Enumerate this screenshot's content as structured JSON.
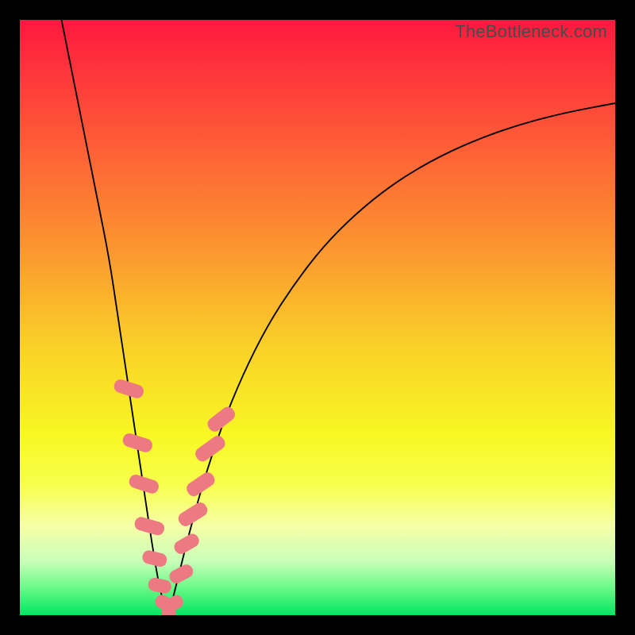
{
  "watermark": "TheBottleneck.com",
  "chart_data": {
    "type": "line",
    "title": "",
    "xlabel": "",
    "ylabel": "",
    "xlim": [
      0,
      100
    ],
    "ylim": [
      0,
      100
    ],
    "gradient_stops": [
      {
        "offset": 0.0,
        "color": "#FF183F"
      },
      {
        "offset": 0.2,
        "color": "#FE5A37"
      },
      {
        "offset": 0.4,
        "color": "#FC9B2F"
      },
      {
        "offset": 0.55,
        "color": "#FAD128"
      },
      {
        "offset": 0.7,
        "color": "#F8F823"
      },
      {
        "offset": 0.78,
        "color": "#F7FF4C"
      },
      {
        "offset": 0.85,
        "color": "#F6FFA6"
      },
      {
        "offset": 0.91,
        "color": "#C8FFB9"
      },
      {
        "offset": 0.955,
        "color": "#68F886"
      },
      {
        "offset": 1.0,
        "color": "#00E762"
      }
    ],
    "series": [
      {
        "name": "left-branch",
        "x": [
          7.0,
          9.0,
          11.0,
          13.0,
          15.0,
          16.5,
          18.0,
          19.5,
          21.0,
          22.2,
          23.2,
          24.0,
          24.6,
          25.0
        ],
        "y": [
          100.0,
          90.0,
          80.0,
          70.0,
          60.0,
          50.0,
          40.0,
          30.0,
          20.0,
          12.0,
          6.0,
          2.5,
          0.8,
          0.0
        ]
      },
      {
        "name": "right-branch",
        "x": [
          25.0,
          26.5,
          28.5,
          31.0,
          34.0,
          37.5,
          41.5,
          46.0,
          51.0,
          56.5,
          62.5,
          69.0,
          76.0,
          83.5,
          91.5,
          100.0
        ],
        "y": [
          0.0,
          6.0,
          14.0,
          23.0,
          32.0,
          40.5,
          48.5,
          55.5,
          62.0,
          67.5,
          72.3,
          76.3,
          79.6,
          82.3,
          84.4,
          86.0
        ]
      }
    ],
    "blobs": [
      {
        "x": 18.3,
        "y": 38.0,
        "w": 2.2,
        "h": 5.0,
        "rot": -72
      },
      {
        "x": 19.7,
        "y": 29.0,
        "w": 2.2,
        "h": 5.0,
        "rot": -72
      },
      {
        "x": 20.8,
        "y": 22.0,
        "w": 2.2,
        "h": 5.0,
        "rot": -72
      },
      {
        "x": 21.8,
        "y": 15.0,
        "w": 2.2,
        "h": 5.0,
        "rot": -74
      },
      {
        "x": 22.7,
        "y": 9.5,
        "w": 2.2,
        "h": 4.2,
        "rot": -76
      },
      {
        "x": 23.5,
        "y": 5.0,
        "w": 2.2,
        "h": 3.8,
        "rot": -78
      },
      {
        "x": 24.2,
        "y": 2.0,
        "w": 2.2,
        "h": 3.2,
        "rot": -60
      },
      {
        "x": 25.0,
        "y": 0.5,
        "w": 2.4,
        "h": 2.8,
        "rot": 0
      },
      {
        "x": 25.9,
        "y": 2.0,
        "w": 2.2,
        "h": 3.2,
        "rot": 60
      },
      {
        "x": 27.0,
        "y": 7.0,
        "w": 2.2,
        "h": 4.2,
        "rot": 62
      },
      {
        "x": 28.0,
        "y": 12.0,
        "w": 2.2,
        "h": 4.4,
        "rot": 60
      },
      {
        "x": 29.1,
        "y": 17.0,
        "w": 2.4,
        "h": 5.2,
        "rot": 58
      },
      {
        "x": 30.4,
        "y": 22.0,
        "w": 2.4,
        "h": 5.0,
        "rot": 56
      },
      {
        "x": 32.0,
        "y": 28.0,
        "w": 2.4,
        "h": 5.4,
        "rot": 54
      },
      {
        "x": 33.8,
        "y": 33.0,
        "w": 2.4,
        "h": 5.0,
        "rot": 52
      }
    ]
  }
}
